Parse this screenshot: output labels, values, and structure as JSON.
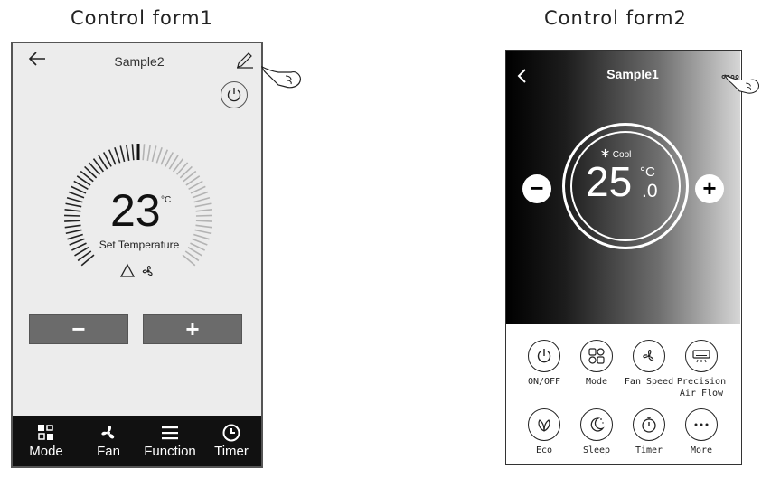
{
  "captions": {
    "form1": "Control form1",
    "form2": "Control form2"
  },
  "form1": {
    "title": "Sample2",
    "temperature": "23",
    "unit": "°C",
    "set_label": "Set Temperature",
    "minus_label": "−",
    "plus_label": "+",
    "nav": [
      {
        "label": "Mode",
        "icon": "mode-grid-icon"
      },
      {
        "label": "Fan",
        "icon": "fan-icon"
      },
      {
        "label": "Function",
        "icon": "menu-lines-icon"
      },
      {
        "label": "Timer",
        "icon": "clock-icon"
      }
    ]
  },
  "form2": {
    "title": "Sample1",
    "mode_label": "Cool",
    "temperature": "25",
    "unit": "°C",
    "decimal": ".0",
    "minus_label": "−",
    "plus_label": "+",
    "buttons": [
      {
        "label": "ON/OFF",
        "icon": "power-icon"
      },
      {
        "label": "Mode",
        "icon": "mode-icon"
      },
      {
        "label": "Fan Speed",
        "icon": "fan-icon"
      },
      {
        "label": "Precision Air Flow",
        "icon": "ac-unit-icon"
      },
      {
        "label": "Eco",
        "icon": "leaf-icon"
      },
      {
        "label": "Sleep",
        "icon": "moon-icon"
      },
      {
        "label": "Timer",
        "icon": "timer-icon"
      },
      {
        "label": "More",
        "icon": "more-icon"
      }
    ]
  },
  "colors": {
    "phone1_bg": "#ececec",
    "nav_bg": "#111111",
    "button_grey": "#6b6b6b"
  }
}
